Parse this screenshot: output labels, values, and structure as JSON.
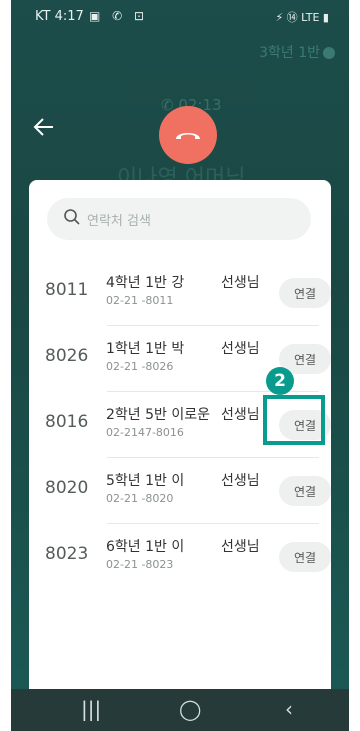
{
  "status_bar": {
    "carrier_time": "KT 4:17",
    "left_icons": "▣ ✆ ⊡",
    "right_icons": "⚡ ⑭ LTE ▮"
  },
  "call": {
    "class_label": "3학년 1반",
    "timer": "02:13",
    "caller": "이나영 어머님"
  },
  "search": {
    "placeholder": "연락처 검색"
  },
  "contacts": [
    {
      "ext": "8011",
      "name": "4학년 1반 강",
      "title": "선생님",
      "phone": "02-21   -8011",
      "action": "연결"
    },
    {
      "ext": "8026",
      "name": "1학년 1반 박",
      "title": "선생님",
      "phone": "02-21   -8026",
      "action": "연결"
    },
    {
      "ext": "8016",
      "name": "2학년 5반 이로운",
      "title": "선생님",
      "phone": "02-2147-8016",
      "action": "연결"
    },
    {
      "ext": "8020",
      "name": "5학년 1반 이",
      "title": "선생님",
      "phone": "02-21   -8020",
      "action": "연결"
    },
    {
      "ext": "8023",
      "name": "6학년 1반 이",
      "title": "선생님",
      "phone": "02-21   -8023",
      "action": "연결"
    }
  ],
  "annotation": {
    "step": "2"
  },
  "nav": {
    "recent": "|||",
    "home": "◯",
    "back": "‹"
  },
  "colors": {
    "background": "#1c4d4a",
    "hangup": "#f07161",
    "accent": "#0a9b8f"
  }
}
